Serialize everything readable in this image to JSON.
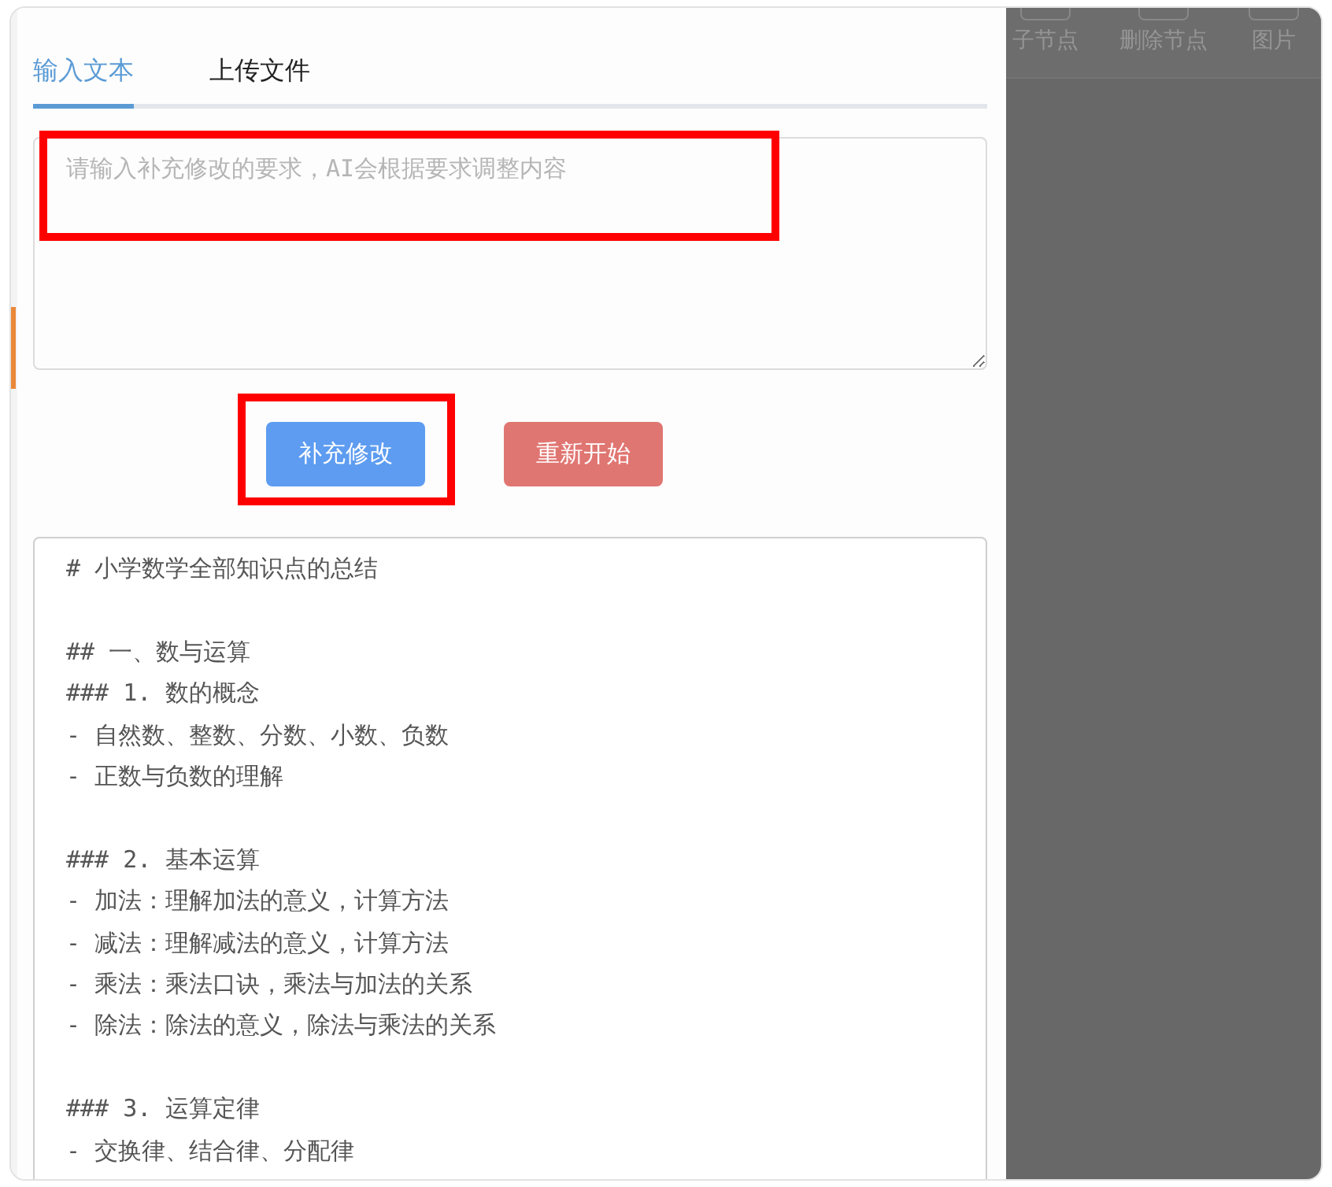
{
  "tabs": [
    {
      "label": "输入文本",
      "selected": true
    },
    {
      "label": "上传文件",
      "selected": false
    }
  ],
  "request_field": {
    "placeholder": "请输入补充修改的要求，AI会根据要求调整内容",
    "highlighted": true
  },
  "buttons": [
    {
      "label": "补充修改",
      "kind": "primary",
      "highlighted": true
    },
    {
      "label": "重新开始",
      "kind": "danger",
      "highlighted": false
    }
  ],
  "result": {
    "value": "# 小学数学全部知识点的总结\n\n## 一、数与运算\n### 1. 数的概念\n- 自然数、整数、分数、小数、负数\n- 正数与负数的理解\n\n### 2. 基本运算\n- 加法：理解加法的意义，计算方法\n- 减法：理解减法的意义，计算方法\n- 乘法：乘法口诀，乘法与加法的关系\n- 除法：除法的意义，除法与乘法的关系\n\n### 3. 运算定律\n- 交换律、结合律、分配律"
  },
  "toolbar": [
    {
      "label": "子节点"
    },
    {
      "label": "删除节点"
    },
    {
      "label": "图片"
    }
  ]
}
